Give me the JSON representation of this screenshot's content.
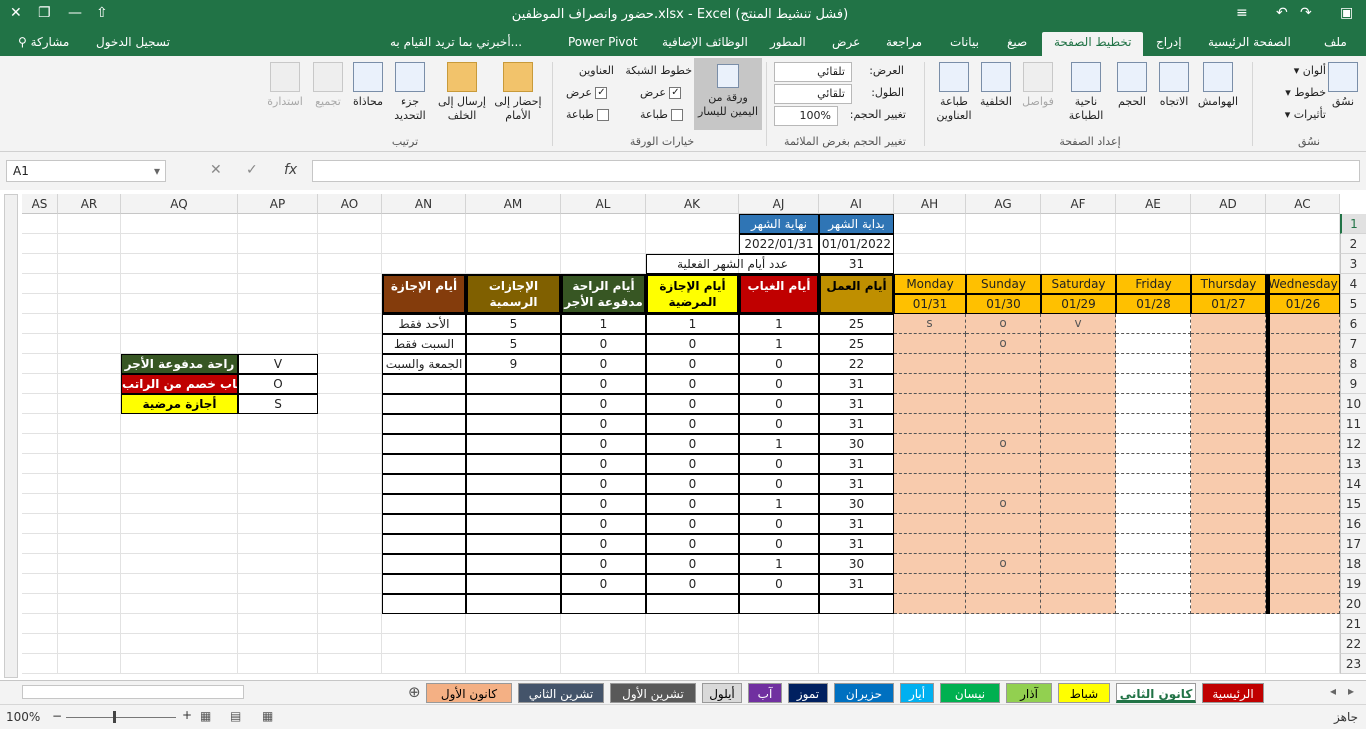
{
  "window": {
    "title": "حضور وانصراف الموظفين.xlsx - Excel (فشل تنشيط المنتج)"
  },
  "ribbon_tabs": [
    "ملف",
    "الصفحة الرئيسية",
    "إدراج",
    "تخطيط الصفحة",
    "صيغ",
    "بيانات",
    "مراجعة",
    "عرض",
    "المطور",
    "الوظائف الإضافية",
    "Power Pivot"
  ],
  "tell_me": "أخبرني بما تريد القيام به...",
  "sign_in": "تسجيل الدخول",
  "share": "مشاركة",
  "ribbon": {
    "themes": {
      "label": "نسُق",
      "colors": "ألوان",
      "fonts": "خطوط",
      "effects": "تأثيرات",
      "group": "نسُق"
    },
    "page_setup": {
      "margins": "الهوامش",
      "orientation": "الاتجاه",
      "size": "الحجم",
      "print_area": "ناحية الطباعة",
      "breaks": "فواصل",
      "background": "الخلفية",
      "print_titles": "طباعة العناوين",
      "group": "إعداد الصفحة"
    },
    "scale": {
      "width": "العرض:",
      "height": "الطول:",
      "scale": "تغيير الحجم:",
      "width_val": "تلقائي",
      "height_val": "تلقائي",
      "scale_val": "100%",
      "group": "تغيير الحجم بغرض الملائمة"
    },
    "sheet_options": {
      "rtl": "ورقة من اليمين لليسار",
      "gridlines": "خطوط الشبكة",
      "headings": "العناوين",
      "view": "عرض",
      "print": "طباعة",
      "group": "خيارات الورقة"
    },
    "arrange": {
      "bring_forward": "إحضار إلى الأمام",
      "send_backward": "إرسال إلى الخلف",
      "selection_pane": "جزء التحديد",
      "align": "محاذاة",
      "group_btn": "تجميع",
      "rotate": "استدارة",
      "group": "ترتيب"
    }
  },
  "formula_bar": {
    "name_box": "A1",
    "formula": "",
    "fx": "fx"
  },
  "columns": [
    "AC",
    "AD",
    "AE",
    "AF",
    "AG",
    "AH",
    "AI",
    "AJ",
    "AK",
    "AL",
    "AM",
    "AN",
    "AO",
    "AP",
    "AQ",
    "AR",
    "AS"
  ],
  "rows": [
    "1",
    "2",
    "3",
    "4",
    "5",
    "6",
    "7",
    "8",
    "9",
    "10",
    "11",
    "12",
    "13",
    "14",
    "15",
    "16",
    "17",
    "18",
    "19",
    "20",
    "21",
    "22",
    "23"
  ],
  "header_cells": {
    "start_label": "بداية الشهر",
    "end_label": "نهاية الشهر",
    "start_date": "01/01/2022",
    "end_date": "2022/01/31",
    "actual_days_label": "عدد أيام الشهر الفعلية",
    "actual_days": "31"
  },
  "days": [
    {
      "name": "Monday",
      "date": "01/31"
    },
    {
      "name": "Sunday",
      "date": "01/30"
    },
    {
      "name": "Saturday",
      "date": "01/29"
    },
    {
      "name": "Friday",
      "date": "01/28"
    },
    {
      "name": "Thursday",
      "date": "01/27"
    },
    {
      "name": "Wednesday",
      "date": "01/26"
    }
  ],
  "summary_headers": {
    "work": "أيام العمل",
    "absence": "أيام الغياب",
    "sick": "أيام الإجازة المرضية",
    "paid_rest": "أيام الراحة مدفوعة الأجر",
    "official": "الإجازات الرسمية",
    "vacation_days": "أيام الإجازة"
  },
  "summary_rows": [
    {
      "work": "25",
      "absence": "1",
      "sick": "1",
      "paid": "1",
      "official": "5",
      "vacation": "الأحد فقط",
      "marks": [
        "s",
        "o",
        "v",
        "",
        "",
        ""
      ]
    },
    {
      "work": "25",
      "absence": "1",
      "sick": "0",
      "paid": "0",
      "official": "5",
      "vacation": "السبت فقط",
      "marks": [
        "",
        "o",
        "",
        "",
        "",
        ""
      ]
    },
    {
      "work": "22",
      "absence": "0",
      "sick": "0",
      "paid": "0",
      "official": "9",
      "vacation": "الجمعة والسبت",
      "marks": [
        "",
        "",
        "",
        "",
        "",
        ""
      ]
    },
    {
      "work": "31",
      "absence": "0",
      "sick": "0",
      "paid": "0",
      "official": "",
      "vacation": "",
      "marks": [
        "",
        "",
        "",
        "",
        "",
        ""
      ]
    },
    {
      "work": "31",
      "absence": "0",
      "sick": "0",
      "paid": "0",
      "official": "",
      "vacation": "",
      "marks": [
        "",
        "",
        "",
        "",
        "",
        ""
      ]
    },
    {
      "work": "31",
      "absence": "0",
      "sick": "0",
      "paid": "0",
      "official": "",
      "vacation": "",
      "marks": [
        "",
        "",
        "",
        "",
        "",
        ""
      ]
    },
    {
      "work": "30",
      "absence": "1",
      "sick": "0",
      "paid": "0",
      "official": "",
      "vacation": "",
      "marks": [
        "",
        "o",
        "",
        "",
        "",
        ""
      ]
    },
    {
      "work": "31",
      "absence": "0",
      "sick": "0",
      "paid": "0",
      "official": "",
      "vacation": "",
      "marks": [
        "",
        "",
        "",
        "",
        "",
        ""
      ]
    },
    {
      "work": "31",
      "absence": "0",
      "sick": "0",
      "paid": "0",
      "official": "",
      "vacation": "",
      "marks": [
        "",
        "",
        "",
        "",
        "",
        ""
      ]
    },
    {
      "work": "30",
      "absence": "1",
      "sick": "0",
      "paid": "0",
      "official": "",
      "vacation": "",
      "marks": [
        "",
        "o",
        "",
        "",
        "",
        ""
      ]
    },
    {
      "work": "31",
      "absence": "0",
      "sick": "0",
      "paid": "0",
      "official": "",
      "vacation": "",
      "marks": [
        "",
        "",
        "",
        "",
        "",
        ""
      ]
    },
    {
      "work": "31",
      "absence": "0",
      "sick": "0",
      "paid": "0",
      "official": "",
      "vacation": "",
      "marks": [
        "",
        "",
        "",
        "",
        "",
        ""
      ]
    },
    {
      "work": "30",
      "absence": "1",
      "sick": "0",
      "paid": "0",
      "official": "",
      "vacation": "",
      "marks": [
        "",
        "o",
        "",
        "",
        "",
        ""
      ]
    },
    {
      "work": "31",
      "absence": "0",
      "sick": "0",
      "paid": "0",
      "official": "",
      "vacation": "",
      "marks": [
        "",
        "",
        "",
        "",
        "",
        ""
      ]
    }
  ],
  "legend": [
    {
      "code": "V",
      "label": "راحة مدفوعة الأجر",
      "color": "#375623"
    },
    {
      "code": "O",
      "label": "غياب خصم من الراتب",
      "color": "#c00000"
    },
    {
      "code": "S",
      "label": "أجازة مرضية",
      "color": "#ffff00"
    }
  ],
  "sheet_tabs": [
    {
      "label": "الرئيسية",
      "color": "#c00000",
      "text": "#ffffff"
    },
    {
      "label": "كانون الثاني",
      "color": "#ffffff",
      "text": "#217346"
    },
    {
      "label": "شباط",
      "color": "#ffff00",
      "text": "#000000"
    },
    {
      "label": "آذار",
      "color": "#92d050",
      "text": "#000000"
    },
    {
      "label": "نيسان",
      "color": "#00b050",
      "text": "#ffffff"
    },
    {
      "label": "أيار",
      "color": "#00b0f0",
      "text": "#ffffff"
    },
    {
      "label": "حزيران",
      "color": "#0070c0",
      "text": "#ffffff"
    },
    {
      "label": "تموز",
      "color": "#002060",
      "text": "#ffffff"
    },
    {
      "label": "آب",
      "color": "#7030a0",
      "text": "#ffffff"
    },
    {
      "label": "أيلول",
      "color": "#d9d9d9",
      "text": "#000000"
    },
    {
      "label": "تشرين الأول",
      "color": "#595959",
      "text": "#ffffff"
    },
    {
      "label": "تشرين الثاني",
      "color": "#44546a",
      "text": "#ffffff"
    },
    {
      "label": "كانون الأول",
      "color": "#f4b084",
      "text": "#000000"
    }
  ],
  "status": {
    "ready": "جاهز",
    "zoom": "100%"
  },
  "colors": {
    "excel_green": "#217346",
    "peach": "#f8cbad",
    "day_header": "#ffc000",
    "work_header": "#bf8f00",
    "absence_header": "#c00000",
    "sick_header": "#ffff00",
    "paid_header": "#375623",
    "official_header": "#806000",
    "vacation_header": "#843c0c"
  }
}
